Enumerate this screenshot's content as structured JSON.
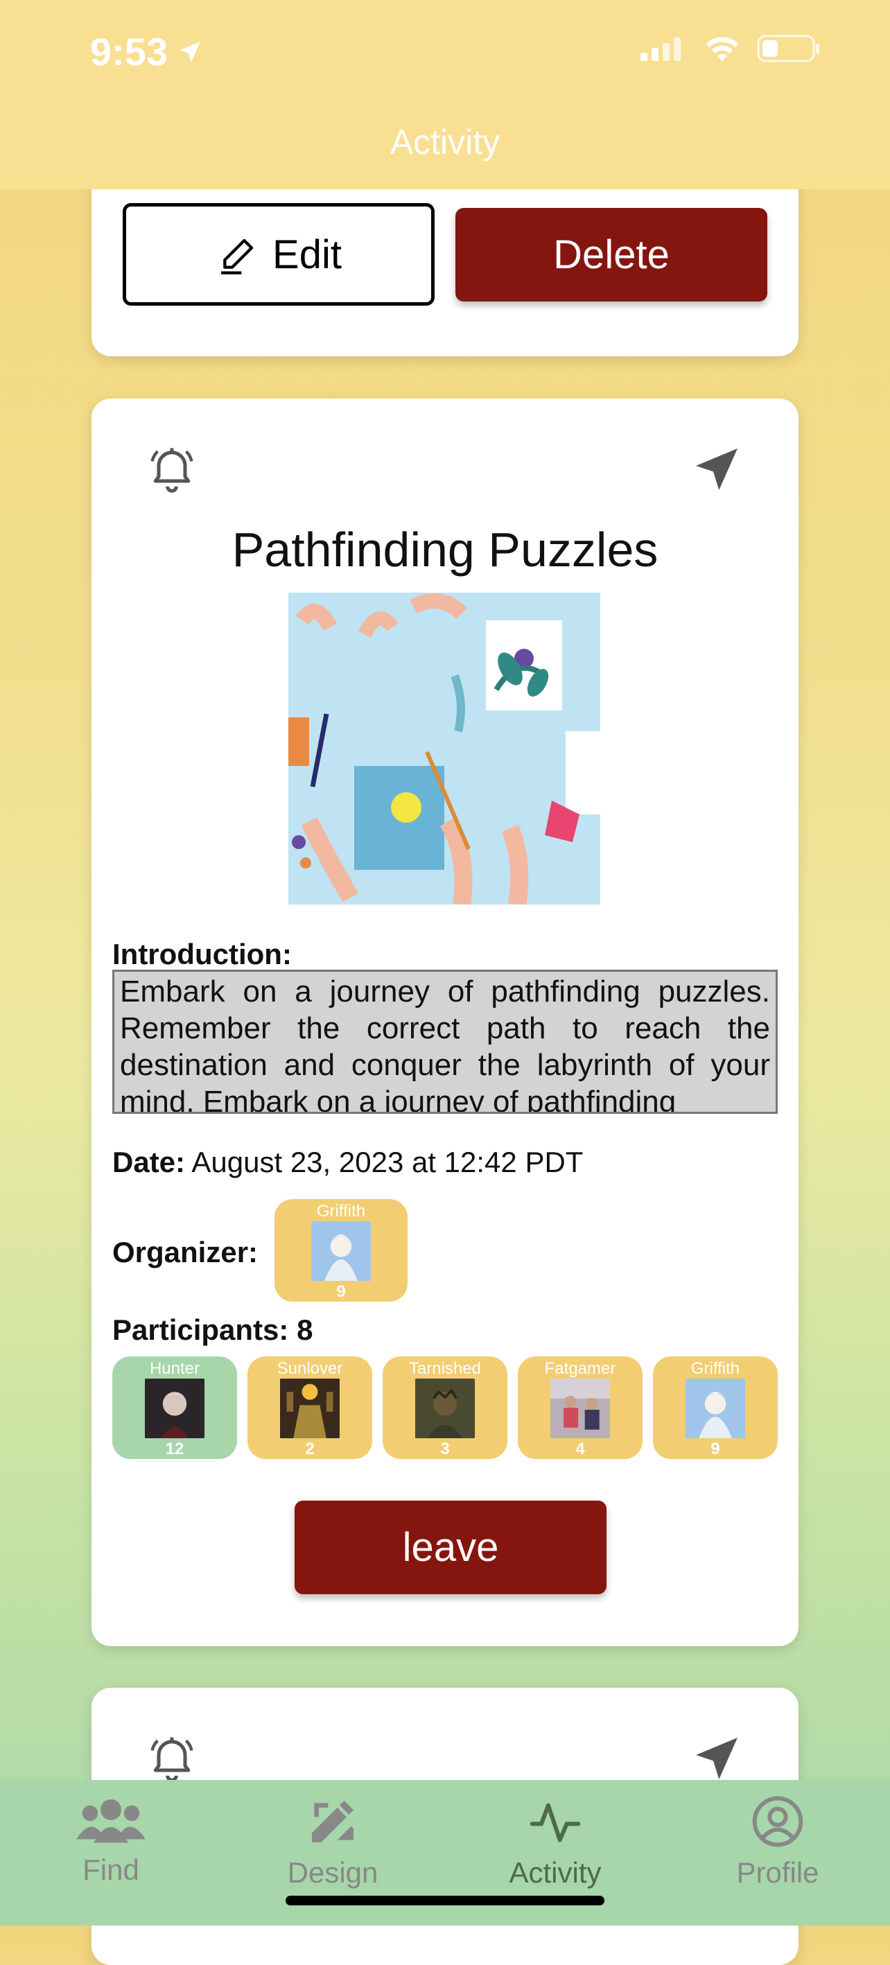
{
  "status": {
    "time": "9:53"
  },
  "header": {
    "title": "Activity"
  },
  "top_card": {
    "edit_label": "Edit",
    "delete_label": "Delete"
  },
  "activity": {
    "title": "Pathfinding Puzzles",
    "intro_label": "Introduction:",
    "intro_text": "Embark on a journey of pathfinding puzzles. Remember the correct path to reach the destination and conquer the labyrinth of your mind. Embark on a journey of pathfinding",
    "date_label": "Date:",
    "date_value": "August 23, 2023 at 12:42 PDT",
    "organizer_label": "Organizer:",
    "organizer": {
      "name": "Griffith",
      "level": "9"
    },
    "participants_label": "Participants: 8",
    "participants": [
      {
        "name": "Hunter",
        "level": "12",
        "bg": "#a6d6a9"
      },
      {
        "name": "Sunlover",
        "level": "2",
        "bg": "#f2cd72"
      },
      {
        "name": "Tarnished",
        "level": "3",
        "bg": "#f2cd72"
      },
      {
        "name": "Fatgamer",
        "level": "4",
        "bg": "#f2cd72"
      },
      {
        "name": "Griffith",
        "level": "9",
        "bg": "#f2cd72"
      }
    ],
    "leave_label": "leave"
  },
  "tabs": [
    {
      "label": "Find",
      "icon": "group-icon"
    },
    {
      "label": "Design",
      "icon": "pencil-ruler-icon"
    },
    {
      "label": "Activity",
      "icon": "activity-pulse-icon"
    },
    {
      "label": "Profile",
      "icon": "profile-circle-icon"
    }
  ],
  "colors": {
    "accent": "#84160f",
    "header": "#f8df92",
    "tabbar": "#a6d6a9",
    "tile": "#f2cd72"
  }
}
